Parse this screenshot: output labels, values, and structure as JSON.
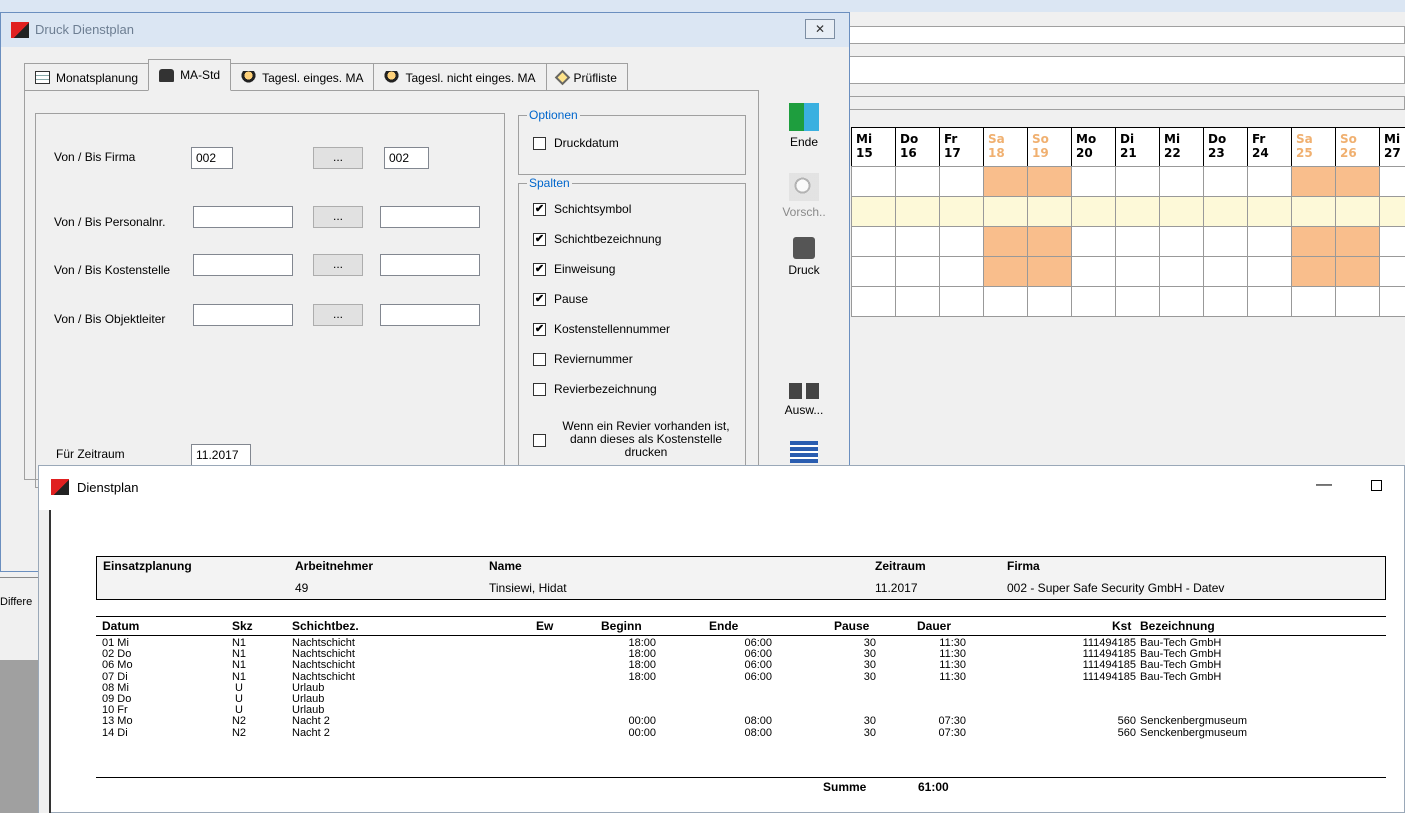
{
  "calendar": {
    "days": [
      {
        "wd": "Mi",
        "d": "15",
        "we": false
      },
      {
        "wd": "Do",
        "d": "16",
        "we": false
      },
      {
        "wd": "Fr",
        "d": "17",
        "we": false
      },
      {
        "wd": "Sa",
        "d": "18",
        "we": true
      },
      {
        "wd": "So",
        "d": "19",
        "we": true
      },
      {
        "wd": "Mo",
        "d": "20",
        "we": false
      },
      {
        "wd": "Di",
        "d": "21",
        "we": false
      },
      {
        "wd": "Mi",
        "d": "22",
        "we": false
      },
      {
        "wd": "Do",
        "d": "23",
        "we": false
      },
      {
        "wd": "Fr",
        "d": "24",
        "we": false
      },
      {
        "wd": "Sa",
        "d": "25",
        "we": true
      },
      {
        "wd": "So",
        "d": "26",
        "we": true
      },
      {
        "wd": "Mi",
        "d": "27",
        "we": false
      }
    ],
    "colors": {
      "weekend": "#f9be8c",
      "highlight": "#fdf9d8"
    }
  },
  "background": {
    "left_text": "Differe"
  },
  "dialog": {
    "title": "Druck Dienstplan",
    "close": "✕",
    "tabs": [
      {
        "label": "Monatsplanung",
        "icon": "calendar-icon"
      },
      {
        "label": "MA-Std",
        "icon": "printer-icon"
      },
      {
        "label": "Tagesl. einges. MA",
        "icon": "person-icon"
      },
      {
        "label": "Tagesl. nicht einges. MA",
        "icon": "persons-icon"
      },
      {
        "label": "Prüfliste",
        "icon": "checklist-icon"
      }
    ],
    "form": {
      "firma_label": "Von / Bis Firma",
      "firma_from": "002",
      "firma_to": "002",
      "personal_label": "Von / Bis Personalnr.",
      "kosten_label": "Von / Bis Kostenstelle",
      "objekt_label": "Von / Bis Objektleiter",
      "dots": "...",
      "zeitraum_label": "Für Zeitraum",
      "zeitraum_value": "11.2017"
    },
    "optionen": {
      "title": "Optionen",
      "druckdatum": "Druckdatum"
    },
    "spalten": {
      "title": "Spalten",
      "items": [
        {
          "label": "Schichtsymbol",
          "checked": "✔"
        },
        {
          "label": "Schichtbezeichnung",
          "checked": "✔"
        },
        {
          "label": "Einweisung",
          "checked": "✔"
        },
        {
          "label": "Pause",
          "checked": "✔"
        },
        {
          "label": "Kostenstellennummer",
          "checked": "✔"
        },
        {
          "label": "Reviernummer",
          "checked": ""
        },
        {
          "label": "Revierbezeichnung",
          "checked": ""
        },
        {
          "label": "Wenn ein Revier vorhanden ist, dann dieses als Kostenstelle drucken",
          "checked": ""
        }
      ]
    },
    "buttons": {
      "ende": "Ende",
      "vorschau": "Vorsch..",
      "druck": "Druck",
      "auswahl": "Ausw..."
    }
  },
  "dienstplan": {
    "title": "Dienstplan",
    "minimize": "—",
    "header": {
      "einsatzplanung_label": "Einsatzplanung",
      "arbeitnehmer_label": "Arbeitnehmer",
      "arbeitnehmer": "49",
      "name_label": "Name",
      "name": "Tinsiewi, Hidat",
      "zeitraum_label": "Zeitraum",
      "zeitraum": "11.2017",
      "firma_label": "Firma",
      "firma": "002 - Super Safe Security GmbH - Datev"
    },
    "columns": {
      "datum": "Datum",
      "skz": "Skz",
      "schichtbez": "Schichtbez.",
      "ew": "Ew",
      "beginn": "Beginn",
      "ende": "Ende",
      "pause": "Pause",
      "dauer": "Dauer",
      "kst": "Kst",
      "bezeichnung": "Bezeichnung"
    },
    "rows": [
      {
        "datum": "01 Mi",
        "skz": "N1",
        "schicht": "Nachtschicht",
        "beginn": "18:00",
        "ende": "06:00",
        "pause": "30",
        "dauer": "11:30",
        "kst": "111494185",
        "bez": "Bau-Tech GmbH"
      },
      {
        "datum": "02 Do",
        "skz": "N1",
        "schicht": "Nachtschicht",
        "beginn": "18:00",
        "ende": "06:00",
        "pause": "30",
        "dauer": "11:30",
        "kst": "111494185",
        "bez": "Bau-Tech GmbH"
      },
      {
        "datum": "06 Mo",
        "skz": "N1",
        "schicht": "Nachtschicht",
        "beginn": "18:00",
        "ende": "06:00",
        "pause": "30",
        "dauer": "11:30",
        "kst": "111494185",
        "bez": "Bau-Tech GmbH"
      },
      {
        "datum": "07 Di",
        "skz": "N1",
        "schicht": "Nachtschicht",
        "beginn": "18:00",
        "ende": "06:00",
        "pause": "30",
        "dauer": "11:30",
        "kst": "111494185",
        "bez": "Bau-Tech GmbH"
      },
      {
        "datum": "08 Mi",
        "skz": "U",
        "schicht": "Urlaub",
        "beginn": "",
        "ende": "",
        "pause": "",
        "dauer": "",
        "kst": "",
        "bez": ""
      },
      {
        "datum": "09 Do",
        "skz": "U",
        "schicht": "Urlaub",
        "beginn": "",
        "ende": "",
        "pause": "",
        "dauer": "",
        "kst": "",
        "bez": ""
      },
      {
        "datum": "10 Fr",
        "skz": "U",
        "schicht": "Urlaub",
        "beginn": "",
        "ende": "",
        "pause": "",
        "dauer": "",
        "kst": "",
        "bez": ""
      },
      {
        "datum": "13 Mo",
        "skz": "N2",
        "schicht": "Nacht 2",
        "beginn": "00:00",
        "ende": "08:00",
        "pause": "30",
        "dauer": "07:30",
        "kst": "560",
        "bez": "Senckenbergmuseum"
      },
      {
        "datum": "14 Di",
        "skz": "N2",
        "schicht": "Nacht 2",
        "beginn": "00:00",
        "ende": "08:00",
        "pause": "30",
        "dauer": "07:30",
        "kst": "560",
        "bez": "Senckenbergmuseum"
      }
    ],
    "summe_label": "Summe",
    "summe_value": "61:00"
  }
}
